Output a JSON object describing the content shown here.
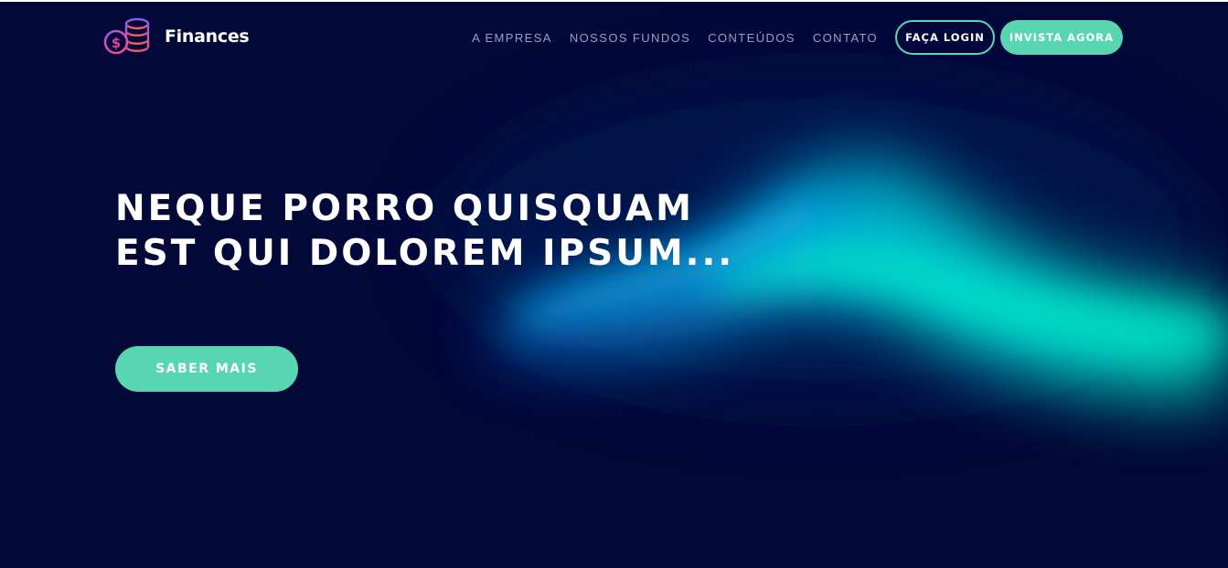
{
  "brand": {
    "name": "Finances",
    "logo_icon": "coins-dollar-icon"
  },
  "nav": {
    "items": [
      {
        "label": "A EMPRESA"
      },
      {
        "label": "NOSSOS FUNDOS"
      },
      {
        "label": "CONTEÚDOS"
      },
      {
        "label": "CONTATO"
      }
    ],
    "login_label": "FAÇA LOGIN",
    "invest_label": "INVISTA AGORA"
  },
  "hero": {
    "title": "NEQUE PORRO QUISQUAM EST QUI DOLOREM IPSUM...",
    "cta_label": "SABER MAIS"
  },
  "colors": {
    "background": "#020838",
    "accent": "#58d6b2",
    "nav_text": "#9aa0bf",
    "glow_blue": "#0aa6e8",
    "glow_teal": "#00e5c8"
  }
}
